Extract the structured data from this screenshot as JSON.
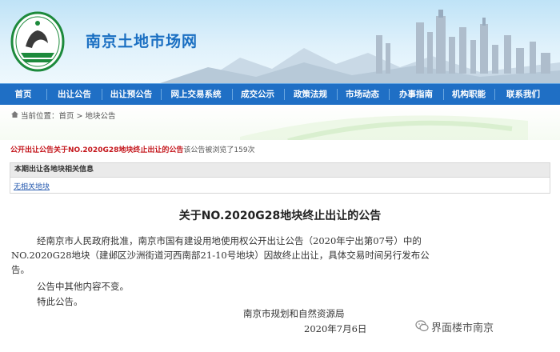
{
  "header": {
    "site_title": "南京土地市场网"
  },
  "nav": {
    "items": [
      "首页",
      "出让公告",
      "出让预公告",
      "网上交易系统",
      "成交公示",
      "政策法规",
      "市场动态",
      "办事指南",
      "机构职能",
      "联系我们"
    ]
  },
  "breadcrumb": {
    "prefix": "当前位置：",
    "home": "首页",
    "sep": " > ",
    "current": "地块公告"
  },
  "notice": {
    "title": "公开出让公告关于NO.2020G28地块终止出让的公告",
    "views_text": "该公告被浏览了159次"
  },
  "info": {
    "heading": "本期出让各地块相关信息",
    "link": "无相关地块"
  },
  "announcement": {
    "title": "关于NO.2020G28地块终止出让的公告",
    "para1_line1": "经南京市人民政府批准，南京市国有建设用地使用权公开出让公告（2020年宁出第07号）中的",
    "para1_line2": "NO.2020G28地块（建邺区沙洲街道河西南部21-10号地块）因故终止出让，具体交易时间另行发布公",
    "para1_line3": "告。",
    "para2": "公告中其他内容不变。",
    "para3": "特此公告。",
    "signer": "南京市规划和自然资源局",
    "date": "2020年7月6日"
  },
  "watermark": {
    "text": "界面楼市南京"
  },
  "colors": {
    "nav": "#1f6fc5",
    "title_blue": "#1a6fc2",
    "notice_red": "#c4161c"
  }
}
